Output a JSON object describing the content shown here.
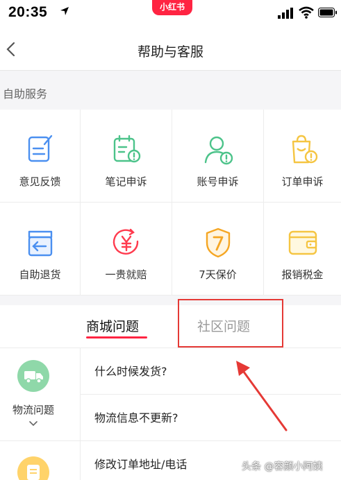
{
  "status_bar": {
    "time": "20:35",
    "app_badge": "小红书",
    "icons": [
      "location-arrow-icon",
      "signal-icon",
      "wifi-icon",
      "battery-icon"
    ]
  },
  "nav": {
    "title": "帮助与客服",
    "back_icon": "chevron-left-icon"
  },
  "self_service": {
    "header": "自助服务",
    "items": [
      {
        "label": "意见反馈",
        "icon": "feedback-icon",
        "color": "#4a8ff0"
      },
      {
        "label": "笔记申诉",
        "icon": "note-appeal-icon",
        "color": "#4cc38a"
      },
      {
        "label": "账号申诉",
        "icon": "account-appeal-icon",
        "color": "#4cc38a"
      },
      {
        "label": "订单申诉",
        "icon": "order-appeal-icon",
        "color": "#f5c542"
      },
      {
        "label": "自助退货",
        "icon": "return-box-icon",
        "color": "#4a8ff0"
      },
      {
        "label": "一贵就赔",
        "icon": "yuan-refund-icon",
        "color": "#ff3b4e"
      },
      {
        "label": "7天保价",
        "icon": "price-shield-icon",
        "color": "#f5a623"
      },
      {
        "label": "报销税金",
        "icon": "wallet-icon",
        "color": "#f5c542"
      }
    ]
  },
  "tabs": [
    {
      "label": "商城问题",
      "active": true
    },
    {
      "label": "社区问题",
      "active": false
    }
  ],
  "category": {
    "label": "物流问题",
    "icon": "truck-icon",
    "color": "#8fd8a9",
    "second_icon": "document-icon",
    "second_color": "#ffd36a"
  },
  "questions": [
    "什么时候发货?",
    "物流信息不更新?",
    "修改订单地址/电话"
  ],
  "watermark": "头条 @容颜小阿姨",
  "accent_color": "#ff2442"
}
